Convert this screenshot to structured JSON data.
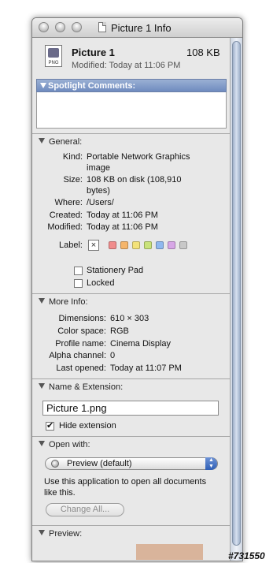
{
  "window": {
    "title": "Picture 1 Info"
  },
  "header": {
    "filename": "Picture 1",
    "size": "108 KB",
    "modified": "Modified: Today at 11:06 PM",
    "icon_label": "PNG"
  },
  "spotlight": {
    "header": "Spotlight Comments:"
  },
  "general": {
    "header": "General:",
    "kind_label": "Kind:",
    "kind_value_1": "Portable Network Graphics",
    "kind_value_2": "image",
    "size_label": "Size:",
    "size_value_1": "108 KB on disk (108,910",
    "size_value_2": "bytes)",
    "where_label": "Where:",
    "where_value": "/Users/",
    "created_label": "Created:",
    "created_value": "Today at 11:06 PM",
    "modified_label": "Modified:",
    "modified_value": "Today at 11:06 PM",
    "label_label": "Label:",
    "label_colors": [
      "#f08c8c",
      "#f5b56a",
      "#f3e27a",
      "#c9e27a",
      "#8fb8ef",
      "#d7a6e6",
      "#c8c8c8"
    ],
    "stationery_label": "Stationery Pad",
    "locked_label": "Locked"
  },
  "more_info": {
    "header": "More Info:",
    "dimensions_label": "Dimensions:",
    "dimensions_value": "610 × 303",
    "colorspace_label": "Color space:",
    "colorspace_value": "RGB",
    "profile_label": "Profile name:",
    "profile_value": "Cinema Display",
    "alpha_label": "Alpha channel:",
    "alpha_value": "0",
    "lastopened_label": "Last opened:",
    "lastopened_value": "Today at 11:07 PM"
  },
  "name_ext": {
    "header": "Name & Extension:",
    "filename_value": "Picture 1.png",
    "hide_extension_label": "Hide extension",
    "hide_extension_checked": true
  },
  "open_with": {
    "header": "Open with:",
    "app_selected": "Preview (default)",
    "description_1": "Use this application to open all documents",
    "description_2": "like this.",
    "change_all_label": "Change All..."
  },
  "preview": {
    "header": "Preview:"
  },
  "watermark": "#731550"
}
